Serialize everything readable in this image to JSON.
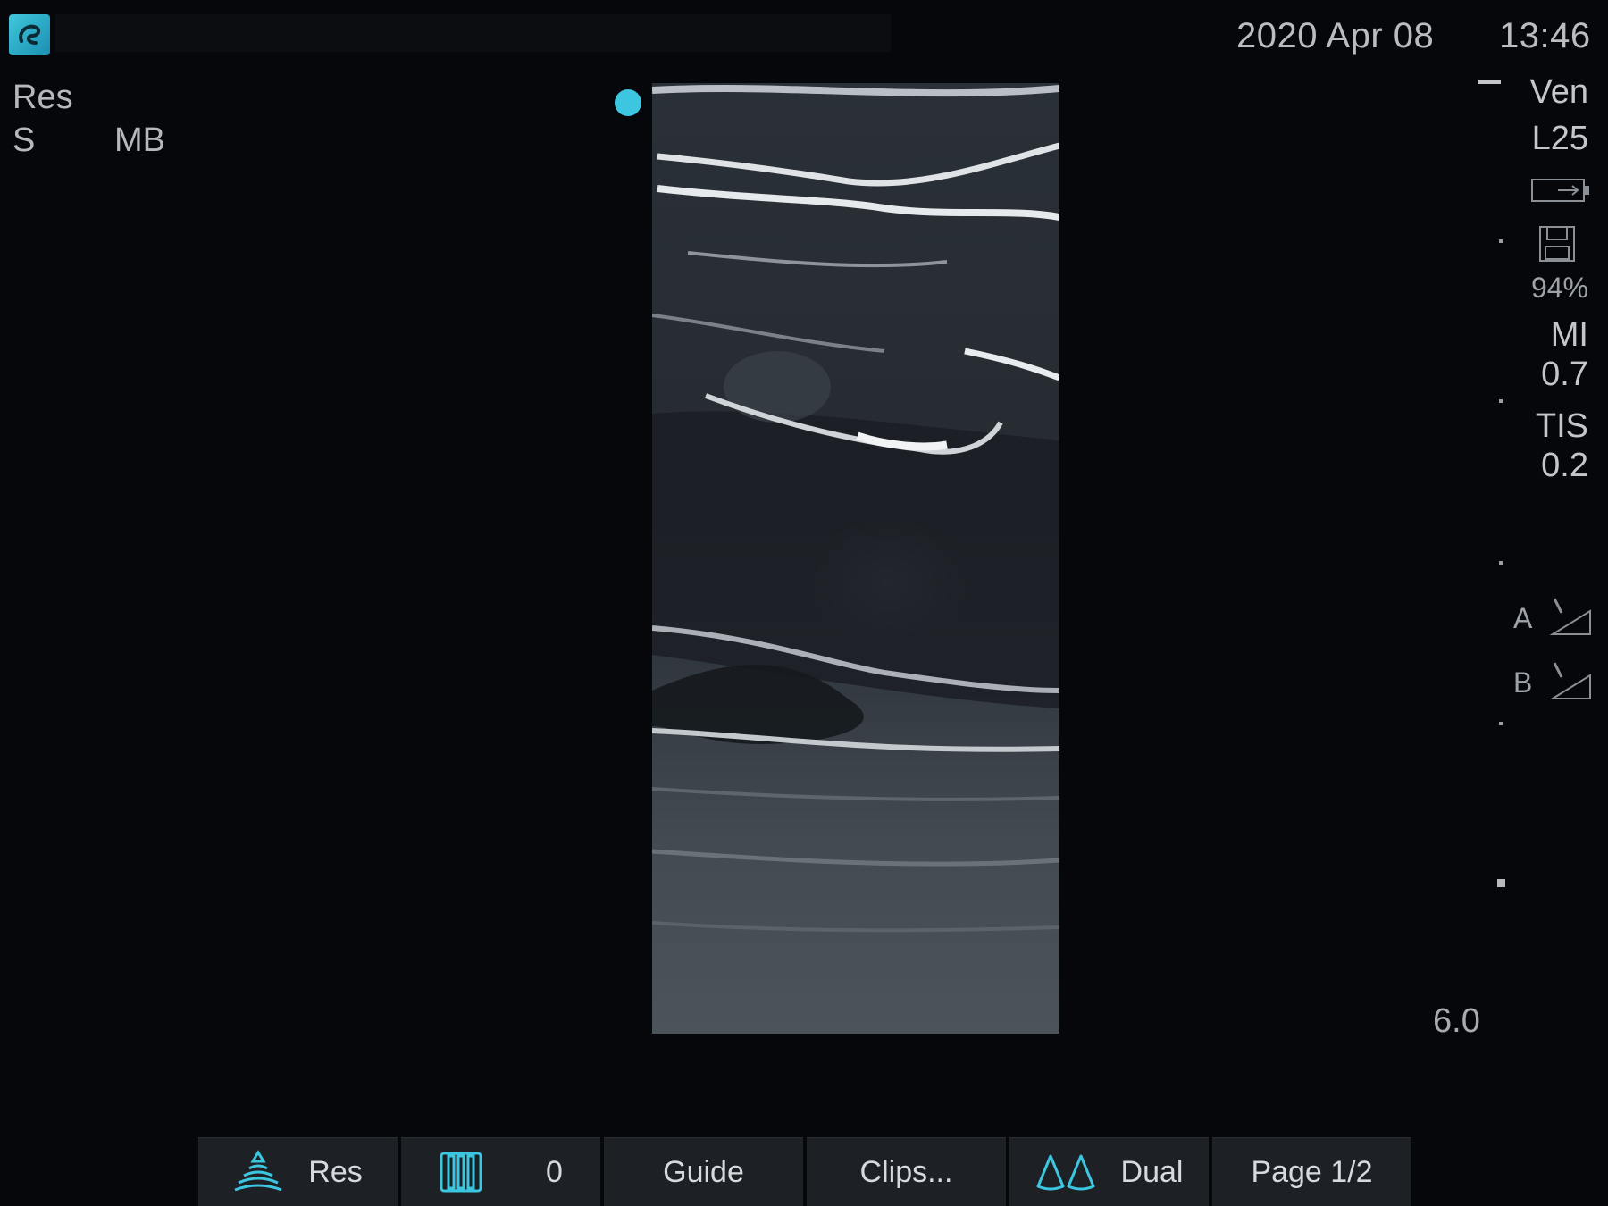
{
  "header": {
    "date": "2020 Apr 08",
    "time": "13:46"
  },
  "left_info": {
    "mode": "Res",
    "line2_a": "S",
    "line2_b": "MB"
  },
  "right_panel": {
    "exam": "Ven",
    "transducer": "L25",
    "battery_pct": "94%",
    "mi_label": "MI",
    "mi_value": "0.7",
    "tis_label": "TIS",
    "tis_value": "0.2",
    "focus_a": "A",
    "focus_b": "B",
    "depth": "6.0"
  },
  "softkeys": [
    {
      "label": "Res",
      "icon": "resolution-fan-icon"
    },
    {
      "label": "0",
      "icon": "needle-profile-icon"
    },
    {
      "label": "Guide",
      "icon": ""
    },
    {
      "label": "Clips...",
      "icon": ""
    },
    {
      "label": "Dual",
      "icon": "dual-image-icon"
    },
    {
      "label": "Page 1/2",
      "icon": ""
    }
  ],
  "colors": {
    "accent": "#3cc6e0",
    "background": "#06070a",
    "softkey_bg": "#1d2024"
  }
}
